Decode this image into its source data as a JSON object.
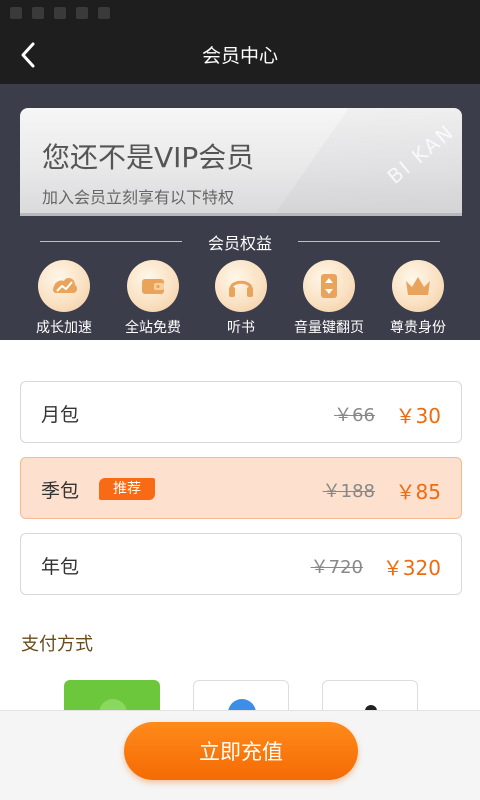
{
  "nav": {
    "title": "会员中心",
    "back_icon": "back-arrow-icon"
  },
  "vip_card": {
    "title": "您还不是VIP会员",
    "subtitle": "加入会员立刻享有以下特权",
    "watermark": "BI KAN"
  },
  "benefits": {
    "heading": "会员权益",
    "items": [
      {
        "label": "成长加速",
        "icon": "growth-chart-icon"
      },
      {
        "label": "全站免费",
        "icon": "wallet-icon"
      },
      {
        "label": "听书",
        "icon": "headphones-icon"
      },
      {
        "label": "音量键翻页",
        "icon": "volume-page-turn-icon"
      },
      {
        "label": "尊贵身份",
        "icon": "crown-icon"
      }
    ]
  },
  "plans": [
    {
      "name": "月包",
      "old_price": "￥66",
      "price": "￥30",
      "selected": false,
      "badge": ""
    },
    {
      "name": "季包",
      "old_price": "￥188",
      "price": "￥85",
      "selected": true,
      "badge": "推荐"
    },
    {
      "name": "年包",
      "old_price": "￥720",
      "price": "￥320",
      "selected": false,
      "badge": ""
    }
  ],
  "payment": {
    "title": "支付方式",
    "options": [
      {
        "icon": "wechat-pay-icon"
      },
      {
        "icon": "alipay-icon"
      },
      {
        "icon": "other-pay-icon"
      }
    ]
  },
  "action": {
    "label": "立即充值"
  },
  "colors": {
    "accent": "#f46b05",
    "header_bg": "#3b3d4a",
    "nav_bg": "#1e1e1e",
    "selected_bg": "#fde0ce",
    "wechat": "#6cc73c"
  }
}
